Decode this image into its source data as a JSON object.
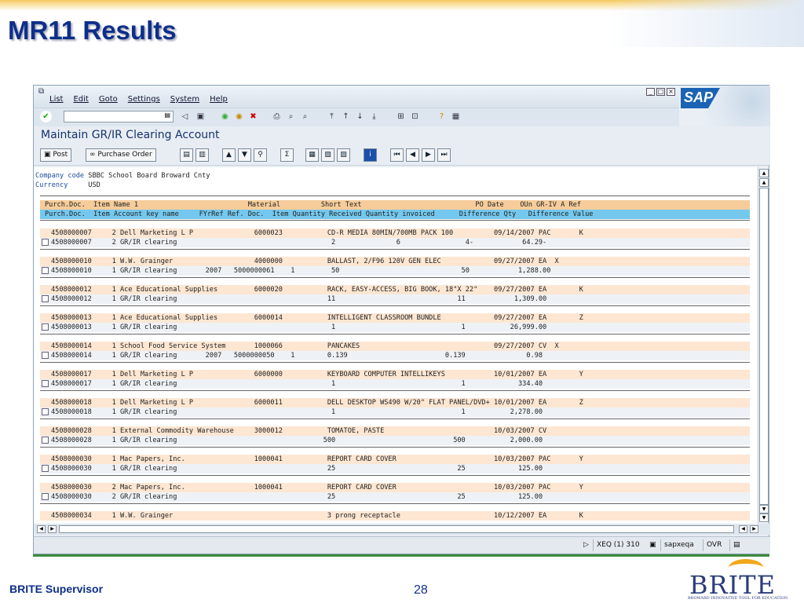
{
  "slide": {
    "title": "MR11 Results",
    "footer_left": "BRITE Supervisor",
    "page_number": "28",
    "logo_word": "BRITE",
    "logo_tagline": "BROWARD INNOVATIVE TOOL FOR EDUCATION"
  },
  "sap": {
    "menu": [
      "List",
      "Edit",
      "Goto",
      "Settings",
      "System",
      "Help"
    ],
    "logo": "SAP",
    "screen_title": "Maintain GR/IR Clearing Account",
    "buttons": {
      "post": "Post",
      "purchase_order": "Purchase Order"
    },
    "header": {
      "company_code_label": "Company code",
      "company_code_value": "SBBC School Board Broward Cnty",
      "currency_label": "Currency",
      "currency_value": "USD"
    },
    "table_head1": "Purch.Doc.  Item Name 1                           Material          Short Text                            PO Date    OUn GR-IV A Ref",
    "table_head2": "Purch.Doc.  Item Account key name     FYrRef Ref. Doc.  Item Quantity Received Quantity invoiced      Difference Qty   Difference Value",
    "rows": [
      {
        "top": "4508000007     2 Dell Marketing L P               6000023           CD-R MEDIA 80MIN/700MB PACK 100          09/14/2007 PAC       K",
        "bottom": "4508000007     2 GR/IR clearing                                      2               6                4-            64.29-"
      },
      {
        "top": "4508000010     1 W.W. Grainger                    4000000           BALLAST, 2/F96 120V GEN ELEC             09/27/2007 EA  X",
        "bottom": "4508000010     1 GR/IR clearing       2007   5000000061    1         50                              50            1,288.00"
      },
      {
        "top": "4508000012     1 Ace Educational Supplies         6000020           RACK, EASY-ACCESS, BIG BOOK, 18\"X 22\"    09/27/2007 EA        K",
        "bottom": "4508000012     1 GR/IR clearing                                     11                              11            1,309.00"
      },
      {
        "top": "4508000013     1 Ace Educational Supplies         6000014           INTELLIGENT CLASSROOM BUNDLE             09/27/2007 EA        Z",
        "bottom": "4508000013     1 GR/IR clearing                                      1                               1           26,999.00"
      },
      {
        "top": "4508000014     1 School Food Service System       1000066           PANCAKES                                 09/27/2007 CV  X",
        "bottom": "4508000014     1 GR/IR clearing       2007   5000000050    1        0.139                        0.139               0.98"
      },
      {
        "top": "4508000017     1 Dell Marketing L P               6000000           KEYBOARD COMPUTER INTELLIKEYS            10/01/2007 EA        Y",
        "bottom": "4508000017     1 GR/IR clearing                                      1                               1             334.40"
      },
      {
        "top": "4508000018     1 Dell Marketing L P               6000011           DELL DESKTOP WS490 W/20\" FLAT PANEL/DVD+ 10/01/2007 EA        Z",
        "bottom": "4508000018     1 GR/IR clearing                                      1                               1           2,278.00"
      },
      {
        "top": "4508000028     1 External Commodity Warehouse     3000012           TOMATOE, PASTE                           10/03/2007 CV",
        "bottom": "4508000028     1 GR/IR clearing                                    500                             500           2,000.00"
      },
      {
        "top": "4508000030     1 Mac Papers, Inc.                 1000041           REPORT CARD COVER                        10/03/2007 PAC       Y",
        "bottom": "4508000030     1 GR/IR clearing                                     25                              25             125.00"
      },
      {
        "top": "4508000030     2 Mac Papers, Inc.                 1000041           REPORT CARD COVER                        10/03/2007 PAC       Y",
        "bottom": "4508000030     2 GR/IR clearing                                     25                              25             125.00"
      },
      {
        "top": "4508000034     1 W.W. Grainger                                      3 prong receptacle                       10/12/2007 EA        K",
        "bottom": ""
      }
    ],
    "status": {
      "transaction": "XEQ (1) 310",
      "server": "sapxeqa",
      "mode": "OVR"
    }
  }
}
